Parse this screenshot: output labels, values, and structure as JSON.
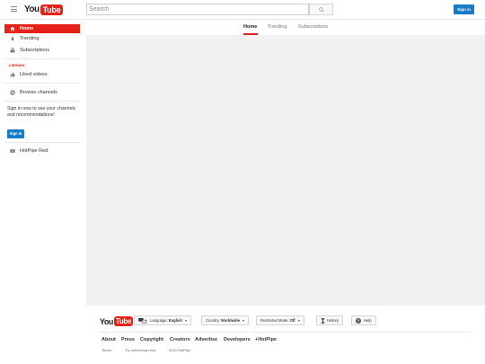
{
  "header": {
    "logo_you": "You",
    "logo_tube": "Tube",
    "search_placeholder": "Search",
    "signin_label": "Sign in"
  },
  "sidebar": {
    "items": [
      {
        "label": "Home",
        "icon": "home-icon"
      },
      {
        "label": "Trending",
        "icon": "flame-icon"
      },
      {
        "label": "Subscriptions",
        "icon": "subscriptions-icon"
      }
    ],
    "library_label": "LIBRARY",
    "liked_label": "Liked videos",
    "browse_label": "Browse channels",
    "signin_message": "Sign in now to see your channels and recommendations!",
    "signin_button": "Sign in",
    "channel_label": "HotPipe Red"
  },
  "main": {
    "tabs": [
      {
        "label": "Home"
      },
      {
        "label": "Trending"
      },
      {
        "label": "Subscriptions"
      }
    ]
  },
  "footer": {
    "logo_you": "You",
    "logo_tube": "Tube",
    "language_prefix": "Language:",
    "language_value": "English",
    "country_prefix": "Country:",
    "country_value": "Worldwide",
    "restricted_prefix": "Restricted Mode:",
    "restricted_value": "Off",
    "history_label": "History",
    "help_label": "Help",
    "links": [
      "About",
      "Press",
      "Copyright",
      "Creators",
      "Advertise",
      "Developers",
      "+HotPipe"
    ],
    "terms": "Terms",
    "try_new": "Try something new!",
    "copyright": "2015 HotPipe"
  },
  "colors": {
    "brand_red": "#e62117",
    "signin_blue": "#167ac6",
    "content_bg": "#f1f1f1"
  }
}
